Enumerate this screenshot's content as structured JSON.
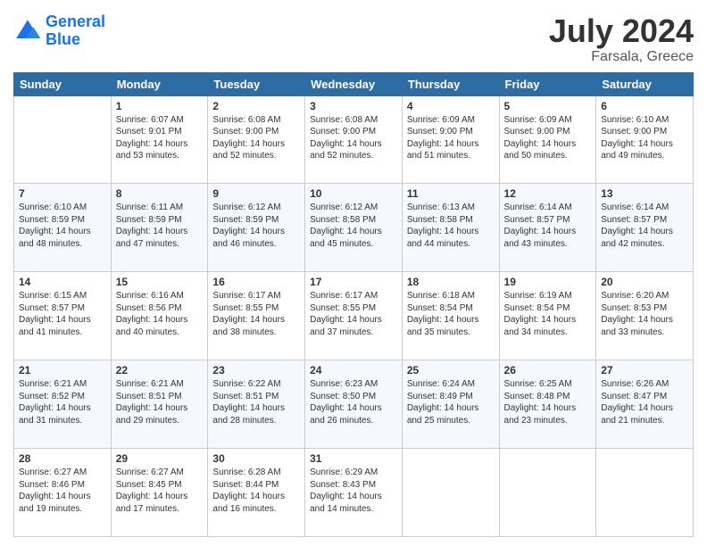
{
  "logo": {
    "line1": "General",
    "line2": "Blue"
  },
  "title": "July 2024",
  "subtitle": "Farsala, Greece",
  "weekdays": [
    "Sunday",
    "Monday",
    "Tuesday",
    "Wednesday",
    "Thursday",
    "Friday",
    "Saturday"
  ],
  "weeks": [
    [
      {
        "day": "",
        "sunrise": "",
        "sunset": "",
        "daylight": ""
      },
      {
        "day": "1",
        "sunrise": "Sunrise: 6:07 AM",
        "sunset": "Sunset: 9:01 PM",
        "daylight": "Daylight: 14 hours and 53 minutes."
      },
      {
        "day": "2",
        "sunrise": "Sunrise: 6:08 AM",
        "sunset": "Sunset: 9:00 PM",
        "daylight": "Daylight: 14 hours and 52 minutes."
      },
      {
        "day": "3",
        "sunrise": "Sunrise: 6:08 AM",
        "sunset": "Sunset: 9:00 PM",
        "daylight": "Daylight: 14 hours and 52 minutes."
      },
      {
        "day": "4",
        "sunrise": "Sunrise: 6:09 AM",
        "sunset": "Sunset: 9:00 PM",
        "daylight": "Daylight: 14 hours and 51 minutes."
      },
      {
        "day": "5",
        "sunrise": "Sunrise: 6:09 AM",
        "sunset": "Sunset: 9:00 PM",
        "daylight": "Daylight: 14 hours and 50 minutes."
      },
      {
        "day": "6",
        "sunrise": "Sunrise: 6:10 AM",
        "sunset": "Sunset: 9:00 PM",
        "daylight": "Daylight: 14 hours and 49 minutes."
      }
    ],
    [
      {
        "day": "7",
        "sunrise": "Sunrise: 6:10 AM",
        "sunset": "Sunset: 8:59 PM",
        "daylight": "Daylight: 14 hours and 48 minutes."
      },
      {
        "day": "8",
        "sunrise": "Sunrise: 6:11 AM",
        "sunset": "Sunset: 8:59 PM",
        "daylight": "Daylight: 14 hours and 47 minutes."
      },
      {
        "day": "9",
        "sunrise": "Sunrise: 6:12 AM",
        "sunset": "Sunset: 8:59 PM",
        "daylight": "Daylight: 14 hours and 46 minutes."
      },
      {
        "day": "10",
        "sunrise": "Sunrise: 6:12 AM",
        "sunset": "Sunset: 8:58 PM",
        "daylight": "Daylight: 14 hours and 45 minutes."
      },
      {
        "day": "11",
        "sunrise": "Sunrise: 6:13 AM",
        "sunset": "Sunset: 8:58 PM",
        "daylight": "Daylight: 14 hours and 44 minutes."
      },
      {
        "day": "12",
        "sunrise": "Sunrise: 6:14 AM",
        "sunset": "Sunset: 8:57 PM",
        "daylight": "Daylight: 14 hours and 43 minutes."
      },
      {
        "day": "13",
        "sunrise": "Sunrise: 6:14 AM",
        "sunset": "Sunset: 8:57 PM",
        "daylight": "Daylight: 14 hours and 42 minutes."
      }
    ],
    [
      {
        "day": "14",
        "sunrise": "Sunrise: 6:15 AM",
        "sunset": "Sunset: 8:57 PM",
        "daylight": "Daylight: 14 hours and 41 minutes."
      },
      {
        "day": "15",
        "sunrise": "Sunrise: 6:16 AM",
        "sunset": "Sunset: 8:56 PM",
        "daylight": "Daylight: 14 hours and 40 minutes."
      },
      {
        "day": "16",
        "sunrise": "Sunrise: 6:17 AM",
        "sunset": "Sunset: 8:55 PM",
        "daylight": "Daylight: 14 hours and 38 minutes."
      },
      {
        "day": "17",
        "sunrise": "Sunrise: 6:17 AM",
        "sunset": "Sunset: 8:55 PM",
        "daylight": "Daylight: 14 hours and 37 minutes."
      },
      {
        "day": "18",
        "sunrise": "Sunrise: 6:18 AM",
        "sunset": "Sunset: 8:54 PM",
        "daylight": "Daylight: 14 hours and 35 minutes."
      },
      {
        "day": "19",
        "sunrise": "Sunrise: 6:19 AM",
        "sunset": "Sunset: 8:54 PM",
        "daylight": "Daylight: 14 hours and 34 minutes."
      },
      {
        "day": "20",
        "sunrise": "Sunrise: 6:20 AM",
        "sunset": "Sunset: 8:53 PM",
        "daylight": "Daylight: 14 hours and 33 minutes."
      }
    ],
    [
      {
        "day": "21",
        "sunrise": "Sunrise: 6:21 AM",
        "sunset": "Sunset: 8:52 PM",
        "daylight": "Daylight: 14 hours and 31 minutes."
      },
      {
        "day": "22",
        "sunrise": "Sunrise: 6:21 AM",
        "sunset": "Sunset: 8:51 PM",
        "daylight": "Daylight: 14 hours and 29 minutes."
      },
      {
        "day": "23",
        "sunrise": "Sunrise: 6:22 AM",
        "sunset": "Sunset: 8:51 PM",
        "daylight": "Daylight: 14 hours and 28 minutes."
      },
      {
        "day": "24",
        "sunrise": "Sunrise: 6:23 AM",
        "sunset": "Sunset: 8:50 PM",
        "daylight": "Daylight: 14 hours and 26 minutes."
      },
      {
        "day": "25",
        "sunrise": "Sunrise: 6:24 AM",
        "sunset": "Sunset: 8:49 PM",
        "daylight": "Daylight: 14 hours and 25 minutes."
      },
      {
        "day": "26",
        "sunrise": "Sunrise: 6:25 AM",
        "sunset": "Sunset: 8:48 PM",
        "daylight": "Daylight: 14 hours and 23 minutes."
      },
      {
        "day": "27",
        "sunrise": "Sunrise: 6:26 AM",
        "sunset": "Sunset: 8:47 PM",
        "daylight": "Daylight: 14 hours and 21 minutes."
      }
    ],
    [
      {
        "day": "28",
        "sunrise": "Sunrise: 6:27 AM",
        "sunset": "Sunset: 8:46 PM",
        "daylight": "Daylight: 14 hours and 19 minutes."
      },
      {
        "day": "29",
        "sunrise": "Sunrise: 6:27 AM",
        "sunset": "Sunset: 8:45 PM",
        "daylight": "Daylight: 14 hours and 17 minutes."
      },
      {
        "day": "30",
        "sunrise": "Sunrise: 6:28 AM",
        "sunset": "Sunset: 8:44 PM",
        "daylight": "Daylight: 14 hours and 16 minutes."
      },
      {
        "day": "31",
        "sunrise": "Sunrise: 6:29 AM",
        "sunset": "Sunset: 8:43 PM",
        "daylight": "Daylight: 14 hours and 14 minutes."
      },
      {
        "day": "",
        "sunrise": "",
        "sunset": "",
        "daylight": ""
      },
      {
        "day": "",
        "sunrise": "",
        "sunset": "",
        "daylight": ""
      },
      {
        "day": "",
        "sunrise": "",
        "sunset": "",
        "daylight": ""
      }
    ]
  ]
}
